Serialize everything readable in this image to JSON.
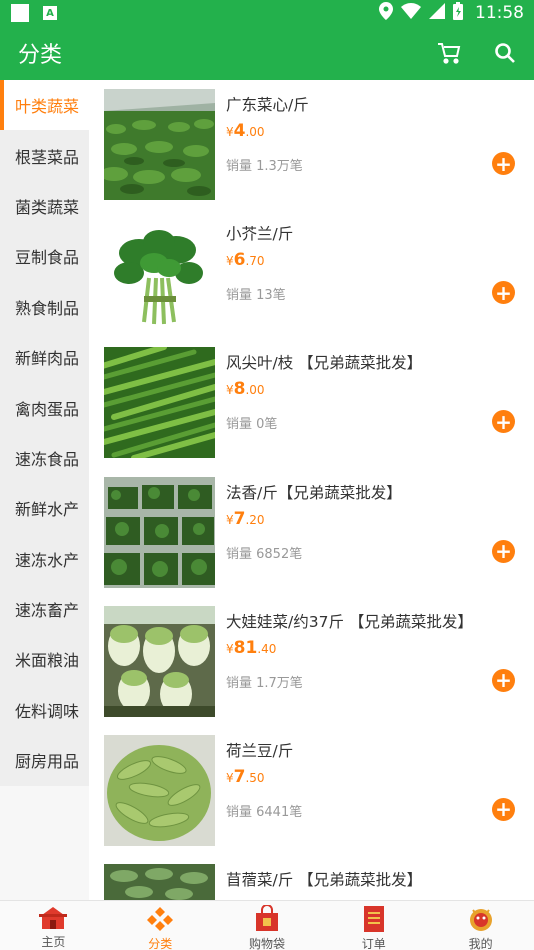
{
  "status": {
    "time": "11:58"
  },
  "appbar": {
    "title": "分类"
  },
  "sidebar": {
    "items": [
      {
        "label": "叶类蔬菜",
        "active": true
      },
      {
        "label": "根茎菜品"
      },
      {
        "label": "菌类蔬菜"
      },
      {
        "label": "豆制食品"
      },
      {
        "label": "熟食制品"
      },
      {
        "label": "新鲜肉品"
      },
      {
        "label": "禽肉蛋品"
      },
      {
        "label": "速冻食品"
      },
      {
        "label": "新鲜水产"
      },
      {
        "label": "速冻水产"
      },
      {
        "label": "速冻畜产"
      },
      {
        "label": "米面粮油"
      },
      {
        "label": "佐料调味"
      },
      {
        "label": "厨房用品"
      }
    ]
  },
  "products": [
    {
      "name": "广东菜心/斤",
      "currency": "¥",
      "price_int": "4",
      "price_dec": ".00",
      "sales": "销量 1.3万笔"
    },
    {
      "name": "小芥兰/斤",
      "currency": "¥",
      "price_int": "6",
      "price_dec": ".70",
      "sales": "销量 13笔"
    },
    {
      "name": "风尖叶/枝 【兄弟蔬菜批发】",
      "currency": "¥",
      "price_int": "8",
      "price_dec": ".00",
      "sales": "销量 0笔"
    },
    {
      "name": "法香/斤【兄弟蔬菜批发】",
      "currency": "¥",
      "price_int": "7",
      "price_dec": ".20",
      "sales": "销量 6852笔"
    },
    {
      "name": "大娃娃菜/约37斤 【兄弟蔬菜批发】",
      "currency": "¥",
      "price_int": "81",
      "price_dec": ".40",
      "sales": "销量 1.7万笔"
    },
    {
      "name": "荷兰豆/斤",
      "currency": "¥",
      "price_int": "7",
      "price_dec": ".50",
      "sales": "销量 6441笔"
    },
    {
      "name": "苜蓿菜/斤 【兄弟蔬菜批发】",
      "currency": "",
      "price_int": "",
      "price_dec": "",
      "sales": ""
    }
  ],
  "bottomnav": {
    "items": [
      {
        "label": "主页",
        "icon": "home-icon"
      },
      {
        "label": "分类",
        "icon": "category-icon",
        "active": true
      },
      {
        "label": "购物袋",
        "icon": "shopping-bag-icon"
      },
      {
        "label": "订单",
        "icon": "order-icon"
      },
      {
        "label": "我的",
        "icon": "profile-icon"
      }
    ]
  },
  "colors": {
    "primary": "#23b14c",
    "accent": "#ff7f0e"
  }
}
